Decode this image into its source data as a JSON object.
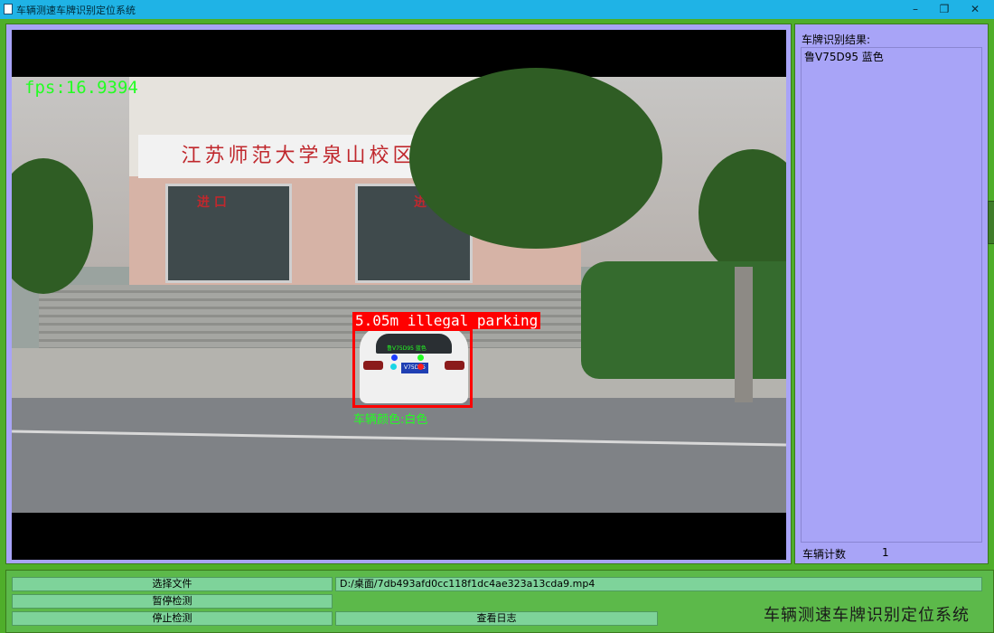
{
  "window": {
    "title": "车辆测速车牌识别定位系统",
    "min_icon": "minimize-icon",
    "max_icon": "restore-icon",
    "close_icon": "close-icon"
  },
  "video": {
    "fps_text": "fps:16.9394",
    "sign_text": "江苏师范大学泉山校区",
    "entrance_left": "进 口",
    "entrance_right": "进 口",
    "detection_label": "5.05m illegal parking",
    "vehicle_color_label": "车辆颜色:白色",
    "plate_small_text": "鲁V75D95 蓝色"
  },
  "side_panel": {
    "title": "车牌识别结果:",
    "result": "鲁V75D95 蓝色",
    "count_label": "车辆计数",
    "count_value": "1"
  },
  "controls": {
    "select_file": "选择文件",
    "pause_detect": "暂停检测",
    "stop_detect": "停止检测",
    "view_log": "查看日志",
    "file_path": "D:/桌面/7db493afd0cc118f1dc4ae323a13cda9.mp4"
  },
  "brand_text": "车辆测速车牌识别定位系统",
  "colors": {
    "window_bg": "#4fae2a",
    "panel_bg": "#a8a4f7",
    "titlebar": "#1fb3e6",
    "button_bg": "#7ed39a",
    "detection_red": "#ff0000",
    "overlay_green": "#22ff22"
  }
}
